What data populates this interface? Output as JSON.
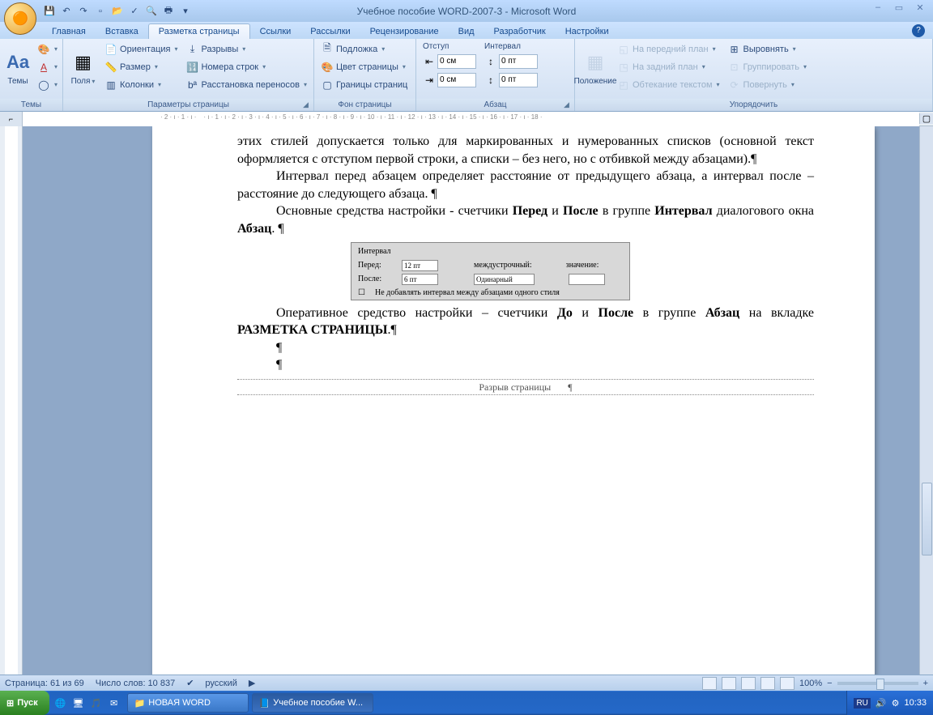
{
  "title": "Учебное пособие WORD-2007-3 - Microsoft Word",
  "qat": [
    "save-icon",
    "undo-icon",
    "redo-icon",
    "new-icon",
    "open-icon",
    "spell-icon",
    "preview-icon",
    "print-icon"
  ],
  "tabs": [
    "Главная",
    "Вставка",
    "Разметка страницы",
    "Ссылки",
    "Рассылки",
    "Рецензирование",
    "Вид",
    "Разработчик",
    "Настройки"
  ],
  "active_tab": 2,
  "ribbon": {
    "themes": {
      "label": "Темы",
      "btn": "Темы"
    },
    "pagesetup": {
      "label": "Параметры страницы",
      "margins": "Поля",
      "orientation": "Ориентация",
      "size": "Размер",
      "columns": "Колонки",
      "breaks": "Разрывы",
      "lines": "Номера строк",
      "hyphen": "Расстановка переносов"
    },
    "pagebg": {
      "label": "Фон страницы",
      "watermark": "Подложка",
      "color": "Цвет страницы",
      "borders": "Границы страниц"
    },
    "paragraph": {
      "label": "Абзац",
      "indent": "Отступ",
      "spacing": "Интервал",
      "left": "0 см",
      "right": "0 см",
      "before": "0 пт",
      "after": "0 пт"
    },
    "arrange": {
      "label": "Упорядочить",
      "position": "Положение",
      "front": "На передний план",
      "back": "На задний план",
      "wrap": "Обтекание текстом",
      "align": "Выровнять",
      "group": "Группировать",
      "rotate": "Повернуть"
    }
  },
  "document": {
    "p1": "этих стилей допускается только для маркированных и нумерованных списков (основной текст оформляется с отступом первой строки, а списки – без него, но с отбивкой между абзацами).¶",
    "p2": "Интервал перед абзацем определяет расстояние от предыдущего абзаца, а интервал после – расстояние до следующего абзаца. ¶",
    "p3a": "Основные средства настройки - счетчики ",
    "p3b": "Перед",
    "p3c": " и ",
    "p3d": "После",
    "p3e": " в группе ",
    "p3f": "Интервал",
    "p3g": " диалогового окна ",
    "p3h": "Абзац",
    "p3i": ". ¶",
    "dlg": {
      "title": "Интервал",
      "before": "Перед:",
      "before_v": "12 пт",
      "after": "После:",
      "after_v": "6 пт",
      "line": "междустрочный:",
      "val": "значение:",
      "line_v": "Одинарный",
      "chk": "Не добавлять интервал между абзацами одного стиля"
    },
    "p4a": "Оперативное средство настройки – счетчики ",
    "p4b": "До",
    "p4c": " и ",
    "p4d": "После",
    "p4e": " в группе ",
    "p4f": "Абзац",
    "p4g": " на вкладке ",
    "p4h": "РАЗМЕТКА СТРАНИЦЫ",
    "p4i": ".¶",
    "pil": "¶",
    "break": "Разрыв страницы"
  },
  "status": {
    "page": "Страница: 61 из 69",
    "words": "Число слов: 10 837",
    "lang": "русский",
    "zoom": "100%"
  },
  "taskbar": {
    "start": "Пуск",
    "folder": "НОВАЯ WORD",
    "doc": "Учебное пособие W...",
    "lang": "RU",
    "time": "10:33"
  }
}
